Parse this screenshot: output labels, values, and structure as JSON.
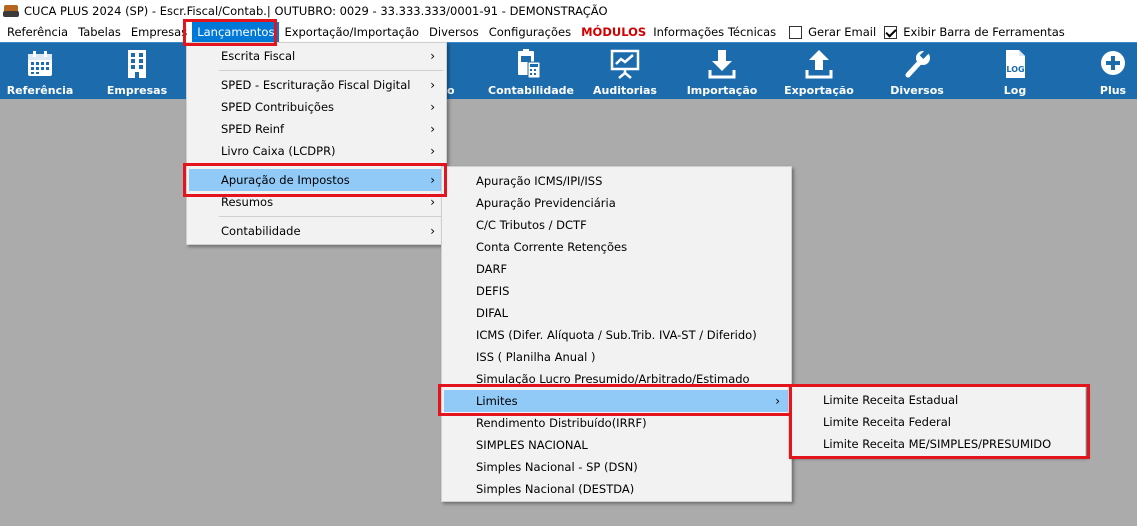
{
  "window": {
    "title": "CUCA PLUS 2024 (SP) - Escr.Fiscal/Contab.| OUTUBRO: 0029 - 33.333.333/0001-91 - DEMONSTRAÇÃO"
  },
  "menubar": {
    "referencia": "Referência",
    "tabelas": "Tabelas",
    "empresas": "Empresas",
    "lancamentos": "Lançamentos",
    "exportacao": "Exportação/Importação",
    "diversos": "Diversos",
    "configuracoes": "Configurações",
    "modulos": "MÓDULOS",
    "informacoes": "Informações Técnicas",
    "gerar_email": "Gerar Email",
    "exibir_barra": "Exibir Barra de Ferramentas",
    "gerar_email_checked": false,
    "exibir_barra_checked": true
  },
  "toolbar": {
    "referencia": "Referência",
    "empresas": "Empresas",
    "hidden_partial": "o",
    "contabilidade": "Contabilidade",
    "auditorias": "Auditorias",
    "importacao": "Importação",
    "exportacao": "Exportação",
    "diversos": "Diversos",
    "log": "Log",
    "log_icon_text": "LOG",
    "plus": "Plus"
  },
  "lancamentos_menu": {
    "escrita_fiscal": "Escrita Fiscal",
    "sped_efd": "SPED - Escrituração Fiscal Digital",
    "sped_contrib": "SPED Contribuições",
    "sped_reinf": "SPED Reinf",
    "livro_caixa": "Livro Caixa (LCDPR)",
    "apuracao": "Apuração de Impostos",
    "resumos": "Resumos",
    "contabilidade": "Contabilidade"
  },
  "apuracao_menu": {
    "icms_ipi_iss": "Apuração ICMS/IPI/ISS",
    "previdenciaria": "Apuração Previdenciária",
    "cc_tributos": "C/C Tributos / DCTF",
    "cc_retencoes": "Conta Corrente Retenções",
    "darf": "DARF",
    "defis": "DEFIS",
    "difal": "DIFAL",
    "icms_difer": "ICMS (Difer. Alíquota / Sub.Trib. IVA-ST / Diferido)",
    "iss_anual": "ISS ( Planilha Anual )",
    "simulacao": "Simulação Lucro Presumido/Arbitrado/Estimado",
    "limites": "Limites",
    "rendimento": "Rendimento Distribuído(IRRF)",
    "simples": "SIMPLES NACIONAL",
    "simples_dsn": "Simples Nacional - SP (DSN)",
    "simples_destda": "Simples Nacional  (DESTDA)"
  },
  "limites_menu": {
    "estadual": "Limite Receita Estadual",
    "federal": "Limite Receita Federal",
    "me_simples": "Limite Receita ME/SIMPLES/PRESUMIDO"
  },
  "colors": {
    "toolbar_bg": "#1c6cad",
    "highlight": "#91c9f7",
    "menu_active": "#0078d7",
    "annotation": "#e3141e",
    "modulos": "#d10000"
  }
}
